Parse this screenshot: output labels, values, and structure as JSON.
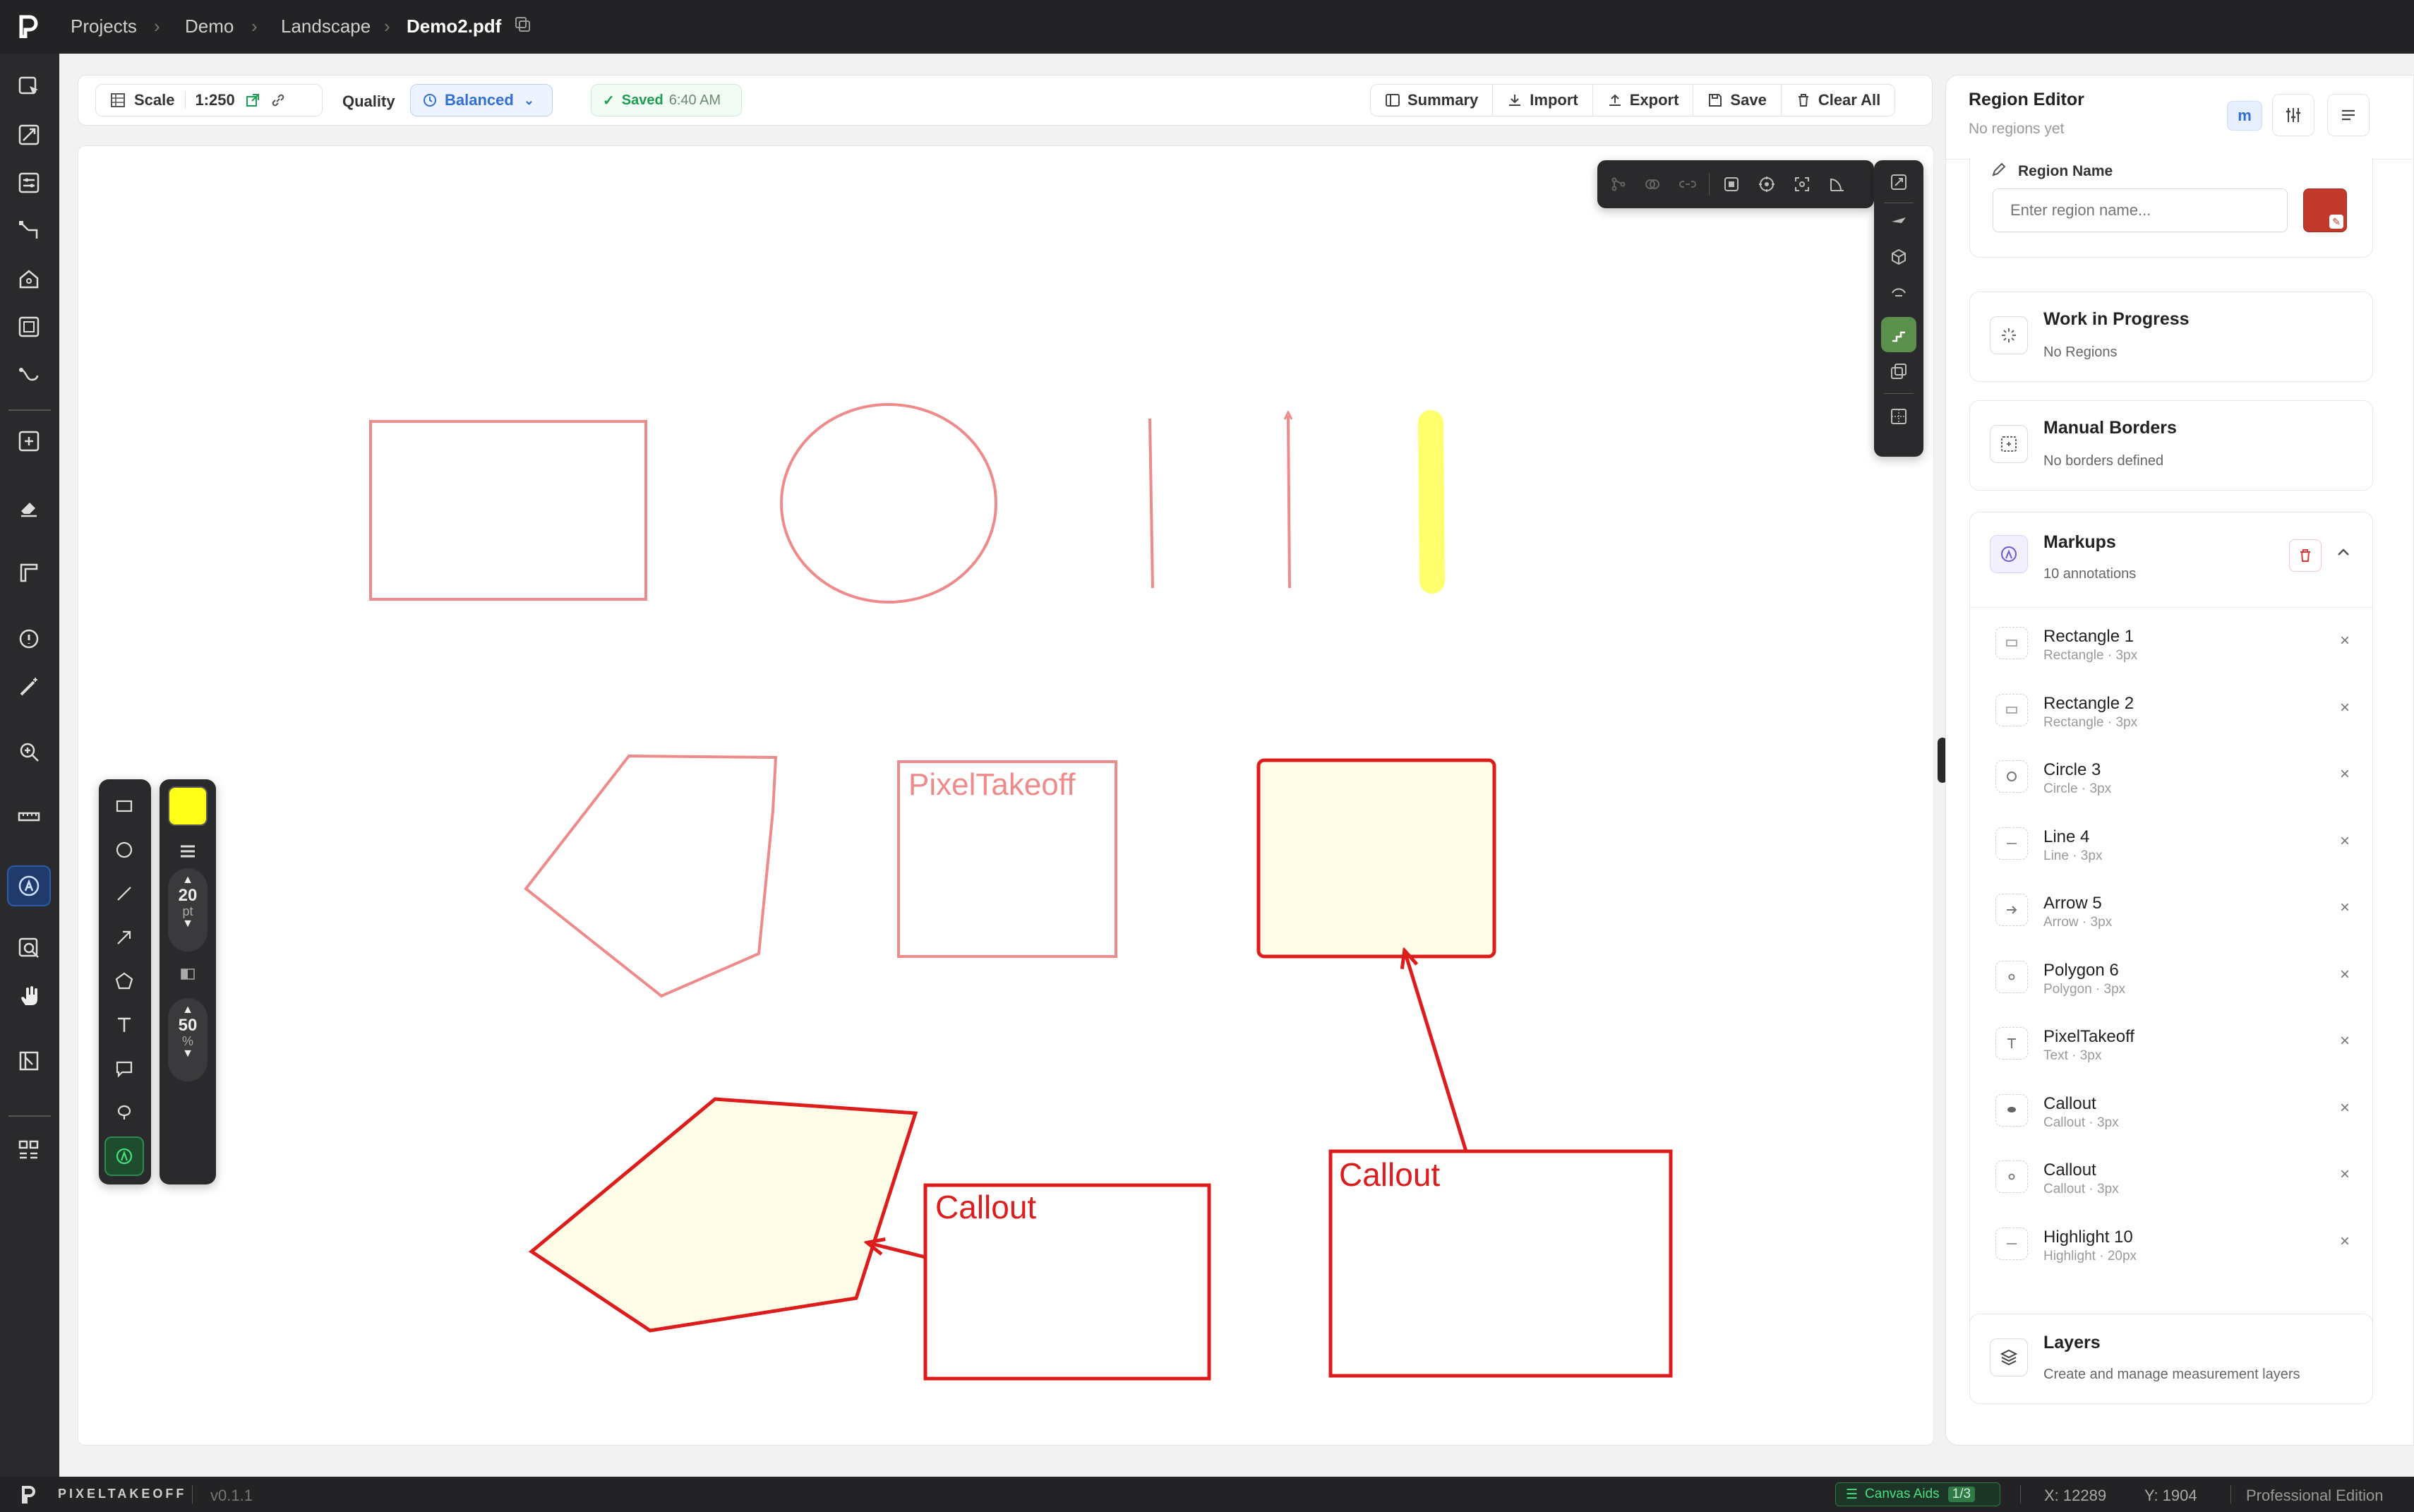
{
  "breadcrumb": {
    "items": [
      "Projects",
      "Demo",
      "Landscape",
      "Demo2.pdf"
    ]
  },
  "toolbar": {
    "scale_label": "Scale",
    "scale_value": "1:250",
    "quality_label": "Quality",
    "quality_value": "Balanced",
    "saved_label": "Saved",
    "saved_time": "6:40 AM",
    "actions": [
      "Summary",
      "Import",
      "Export",
      "Save",
      "Clear All"
    ]
  },
  "canvas": {
    "text_label": "PixelTakeoff",
    "callout_1": "Callout",
    "callout_2": "Callout"
  },
  "drawing_palette": {
    "size_value": "20",
    "size_unit": "pt",
    "opacity_value": "50",
    "opacity_unit": "%",
    "color": "#ffff1a"
  },
  "panel": {
    "title": "Region Editor",
    "subtitle": "No regions yet",
    "mode_badge": "m",
    "region_name_label": "Region Name",
    "region_name_placeholder": "Enter region name...",
    "region_color": "#c0392b",
    "wip_title": "Work in Progress",
    "wip_sub": "No Regions",
    "borders_title": "Manual Borders",
    "borders_sub": "No borders defined",
    "markups_title": "Markups",
    "markups_sub": "10 annotations",
    "markups": [
      {
        "name": "Rectangle 1",
        "meta": "Rectangle · 3px",
        "icon": "rectangle-icon"
      },
      {
        "name": "Rectangle 2",
        "meta": "Rectangle · 3px",
        "icon": "rectangle-icon"
      },
      {
        "name": "Circle 3",
        "meta": "Circle · 3px",
        "icon": "circle-icon"
      },
      {
        "name": "Line 4",
        "meta": "Line · 3px",
        "icon": "line-icon"
      },
      {
        "name": "Arrow 5",
        "meta": "Arrow · 3px",
        "icon": "arrow-icon"
      },
      {
        "name": "Polygon 6",
        "meta": "Polygon · 3px",
        "icon": "polygon-icon"
      },
      {
        "name": "PixelTakeoff",
        "meta": "Text · 3px",
        "icon": "text-icon"
      },
      {
        "name": "Callout",
        "meta": "Callout · 3px",
        "icon": "callout-icon"
      },
      {
        "name": "Callout",
        "meta": "Callout · 3px",
        "icon": "callout-icon"
      },
      {
        "name": "Highlight 10",
        "meta": "Highlight · 20px",
        "icon": "highlight-icon"
      }
    ],
    "layers_title": "Layers",
    "layers_sub": "Create and manage measurement layers"
  },
  "status": {
    "brand": "PIXELTAKEOFF",
    "version": "v0.1.1",
    "canvas_aids": "Canvas Aids",
    "canvas_aids_count": "1/3",
    "coord_x": "X: 12289",
    "coord_y": "Y: 1904",
    "edition": "Professional Edition"
  }
}
